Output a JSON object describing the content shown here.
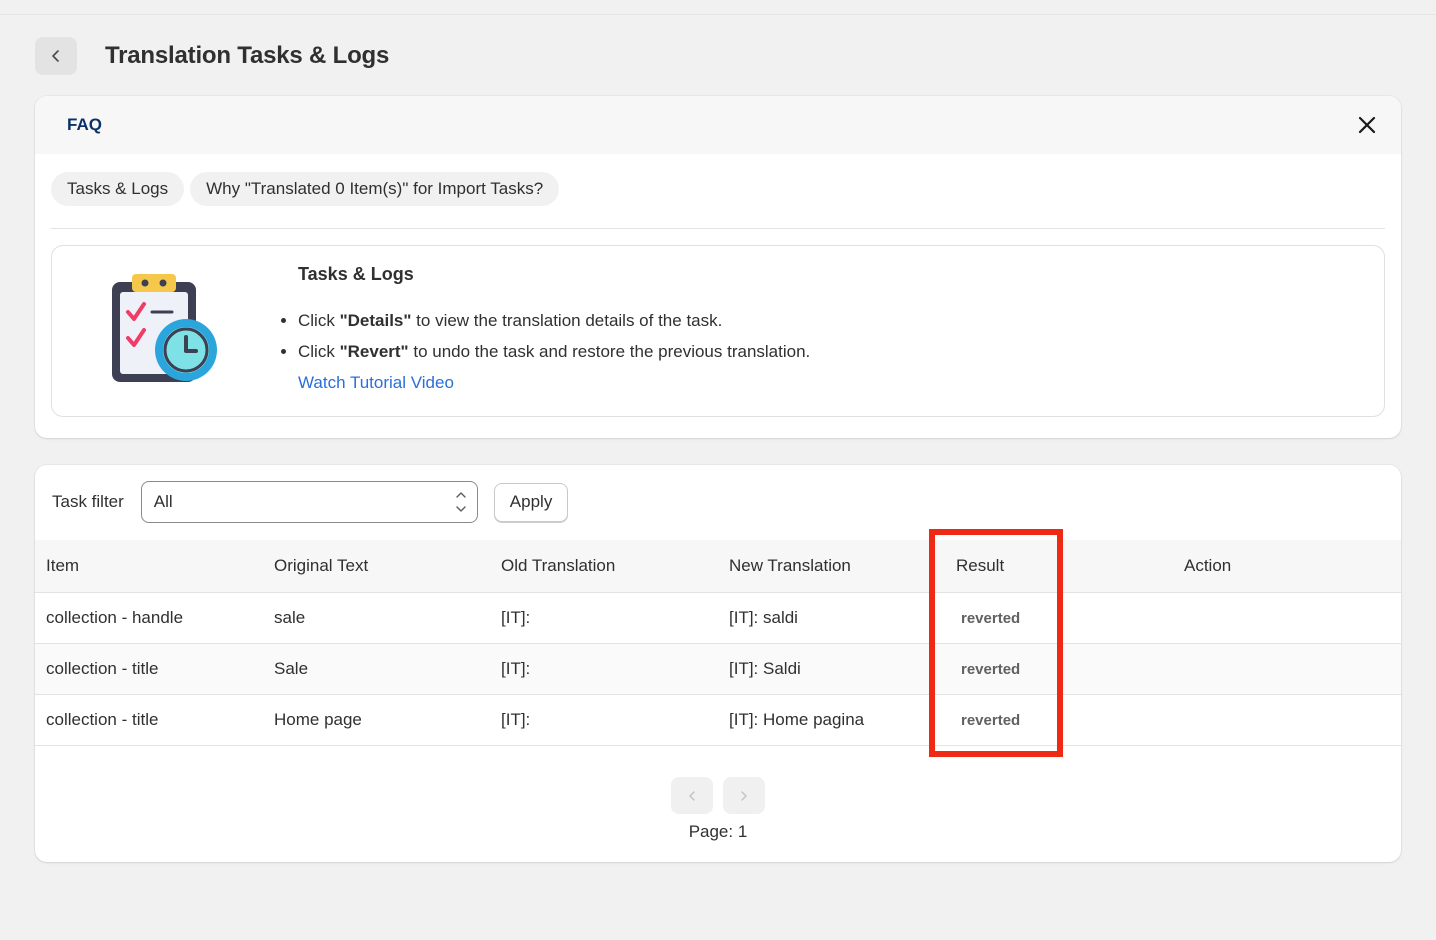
{
  "header": {
    "title": "Translation Tasks & Logs"
  },
  "faq": {
    "title": "FAQ",
    "tabs": [
      "Tasks & Logs",
      "Why \"Translated 0 Item(s)\" for Import Tasks?"
    ],
    "content": {
      "heading": "Tasks & Logs",
      "bullet1": {
        "pre": "Click ",
        "bold": "\"Details\"",
        "post": " to view the translation details of the task."
      },
      "bullet2": {
        "pre": "Click ",
        "bold": "\"Revert\"",
        "post": " to undo the task and restore the previous translation."
      },
      "link": "Watch Tutorial Video"
    }
  },
  "tasks": {
    "filter_label": "Task filter",
    "filter_value": "All",
    "apply_label": "Apply",
    "columns": [
      "Item",
      "Original Text",
      "Old Translation",
      "New Translation",
      "Result",
      "Action"
    ],
    "rows": [
      [
        "collection - handle",
        "sale",
        "[IT]:",
        "[IT]: saldi",
        "reverted",
        ""
      ],
      [
        "collection - title",
        "Sale",
        "[IT]:",
        "[IT]: Saldi",
        "reverted",
        ""
      ],
      [
        "collection - title",
        "Home page",
        "[IT]:",
        "[IT]: Home pagina",
        "reverted",
        ""
      ]
    ],
    "page_label": "Page: 1"
  },
  "colors": {
    "highlight": "#ee2a14",
    "link": "#2a6fdb",
    "faq_title": "#0b3266"
  }
}
